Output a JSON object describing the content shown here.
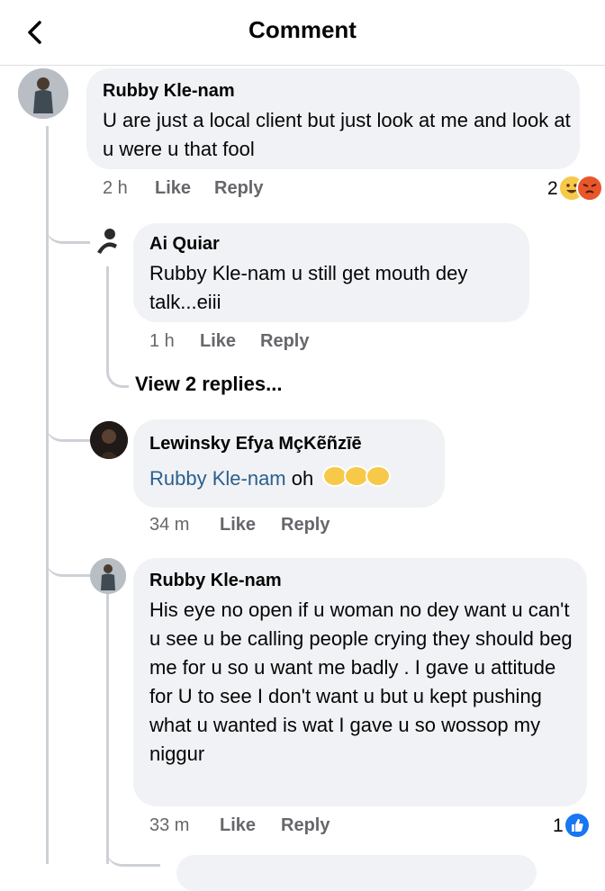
{
  "header": {
    "title": "Comment",
    "back_icon": "chevron-left-icon"
  },
  "comments": [
    {
      "author": "Rubby Kle-nam",
      "text": "U are just a local client but just look at me and look at u were u that fool",
      "time": "2 h",
      "like": "Like",
      "reply": "Reply",
      "reaction_count": "2",
      "reactions": [
        "haha-icon",
        "angry-icon"
      ]
    },
    {
      "author": "Ai Quiar",
      "text": "Rubby Kle-nam u still get mouth dey talk...eiii",
      "time": "1 h",
      "like": "Like",
      "reply": "Reply"
    },
    {
      "view_replies": "View 2 replies..."
    },
    {
      "author": "Lewinsky Efya MçKẽñzīē",
      "mention": "Rubby Kle-nam",
      "text": " oh",
      "emojis": [
        "laughing-icon",
        "laughing-icon",
        "laughing-icon"
      ],
      "time": "34 m",
      "like": "Like",
      "reply": "Reply"
    },
    {
      "author": "Rubby Kle-nam",
      "text": "His eye no open if u woman no dey want u can't u see u be calling people crying they should beg me for u so u want me badly . I gave u attitude for U to see I don't want u but u kept pushing what u wanted is wat I gave u so wossop my niggur",
      "time": "33 m",
      "like": "Like",
      "reply": "Reply",
      "reaction_count": "1",
      "reactions": [
        "like-icon"
      ]
    }
  ],
  "colors": {
    "bubble": "#f0f2f5",
    "meta": "#65676b",
    "mention": "#2a5f8f",
    "like_blue": "#1877f2"
  }
}
